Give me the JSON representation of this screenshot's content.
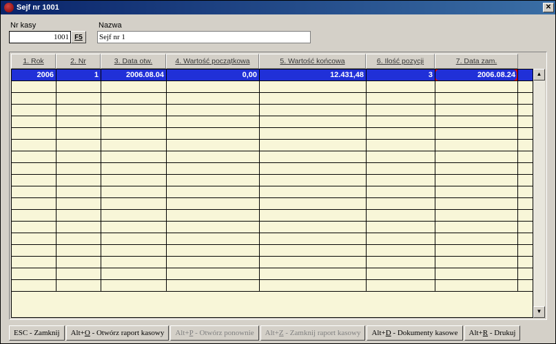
{
  "window": {
    "title": "Sejf nr 1001"
  },
  "fields": {
    "kasa_label": "Nr kasy",
    "kasa_value": "1001",
    "f5_label": "F5",
    "nazwa_label": "Nazwa",
    "nazwa_value": "Sejf nr 1"
  },
  "table": {
    "headers": {
      "rok": "1. Rok",
      "nr": "2. Nr",
      "data_otw": "3. Data otw.",
      "wart_pocz": "4. Wartość początkowa",
      "wart_konc": "5. Wartość końcowa",
      "ilosc": "6. Ilość pozycji",
      "data_zam": "7. Data zam."
    },
    "rows": [
      {
        "rok": "2006",
        "nr": "1",
        "data_otw": "2006.08.04",
        "wart_pocz": "0,00",
        "wart_konc": "12.431,48",
        "ilosc": "3",
        "data_zam": "2006.08.24"
      }
    ]
  },
  "buttons": {
    "esc": "ESC - Zamknij",
    "alto": "Alt+O - Otwórz raport kasowy",
    "altp": "Alt+P - Otwórz ponownie",
    "altz": "Alt+Z - Zamknij raport kasowy",
    "altd": "Alt+D - Dokumenty kasowe",
    "altr": "Alt+R - Drukuj"
  },
  "scroll": {
    "up": "▲",
    "down": "▼"
  },
  "close_glyph": "✕"
}
